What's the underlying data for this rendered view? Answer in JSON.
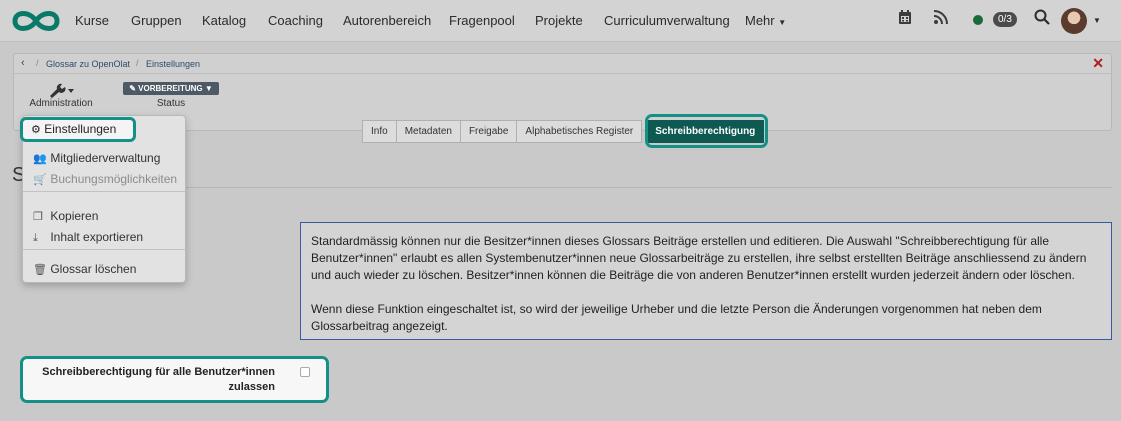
{
  "nav": {
    "items": [
      "Kurse",
      "Gruppen",
      "Katalog",
      "Coaching",
      "Autorenbereich",
      "Fragenpool",
      "Projekte",
      "Curriculumverwaltung",
      "Mehr"
    ],
    "badge": "0/3"
  },
  "breadcrumb": {
    "items": [
      "Glossar zu OpenOlat",
      "Einstellungen"
    ]
  },
  "toolbar": {
    "admin_label": "Administration",
    "status_value": "VORBEREITUNG",
    "status_label": "Status"
  },
  "dropdown": {
    "items": [
      "Einstellungen",
      "Mitgliederverwaltung",
      "Buchungsmöglichkeiten",
      "Kopieren",
      "Inhalt exportieren",
      "Glossar löschen"
    ]
  },
  "tabs": [
    "Info",
    "Metadaten",
    "Freigabe",
    "Alphabetisches Register",
    "Schreibberechtigung"
  ],
  "page": {
    "title": "S"
  },
  "info": {
    "para1": "Standardmässig können nur die Besitzer*innen dieses Glossars Beiträge erstellen und editieren. Die Auswahl \"Schreibberechtigung für alle Benutzer*innen\" erlaubt es allen Systembenutzer*innen neue Glossarbeiträge zu erstellen, ihre selbst erstellten Beiträge anschliessend zu ändern und auch wieder zu löschen. Besitzer*innen können die Beiträge die von anderen Benutzer*innen erstellt wurden jederzeit ändern oder löschen.",
    "para2": "Wenn diese Funktion eingeschaltet ist, so wird der jeweilige Urheber und die letzte Person die Änderungen vorgenommen hat neben dem Glossarbeitrag angezeigt."
  },
  "checkbox": {
    "label": "Schreibberechtigung für alle Benutzer*innen zulassen"
  },
  "colors": {
    "accent": "#149086",
    "tab_active": "#0e5a52",
    "close": "#b01c1c"
  }
}
